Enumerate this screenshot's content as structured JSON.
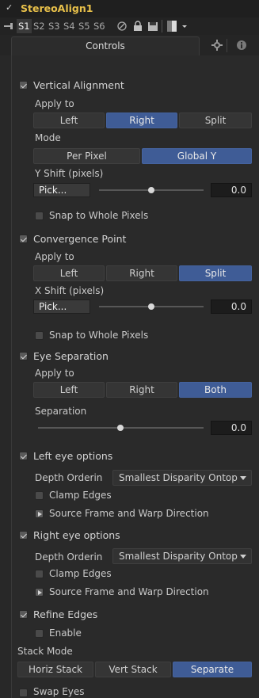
{
  "node": {
    "title": "StereoAlign1"
  },
  "slots": [
    "S1",
    "S2",
    "S3",
    "S4",
    "S5",
    "S6"
  ],
  "tabs": {
    "controls": "Controls"
  },
  "vertical": {
    "title": "Vertical Alignment",
    "apply_label": "Apply to",
    "apply_options": [
      "Left",
      "Right",
      "Split"
    ],
    "apply_selected": "Right",
    "mode_label": "Mode",
    "mode_options": [
      "Per Pixel",
      "Global Y"
    ],
    "mode_selected": "Global Y",
    "shift_label": "Y Shift (pixels)",
    "pick_label": "Pick...",
    "shift_value": "0.0",
    "shift_slider": 0.5,
    "snap_label": "Snap to Whole Pixels"
  },
  "convergence": {
    "title": "Convergence Point",
    "apply_label": "Apply to",
    "apply_options": [
      "Left",
      "Right",
      "Split"
    ],
    "apply_selected": "Split",
    "shift_label": "X Shift (pixels)",
    "pick_label": "Pick...",
    "shift_value": "0.0",
    "shift_slider": 0.5,
    "snap_label": "Snap to Whole Pixels"
  },
  "eye_sep": {
    "title": "Eye Separation",
    "apply_label": "Apply to",
    "apply_options": [
      "Left",
      "Right",
      "Both"
    ],
    "apply_selected": "Both",
    "sep_label": "Separation",
    "sep_value": "0.0",
    "sep_slider": 0.5
  },
  "left_eye": {
    "title": "Left eye options",
    "depth_label": "Depth Orderin",
    "depth_value": "Smallest Disparity Ontop",
    "clamp_label": "Clamp Edges",
    "source_label": "Source Frame and Warp Direction"
  },
  "right_eye": {
    "title": "Right eye options",
    "depth_label": "Depth Orderin",
    "depth_value": "Smallest Disparity Ontop",
    "clamp_label": "Clamp Edges",
    "source_label": "Source Frame and Warp Direction"
  },
  "refine": {
    "title": "Refine Edges",
    "enable_label": "Enable"
  },
  "stack": {
    "label": "Stack Mode",
    "options": [
      "Horiz Stack",
      "Vert Stack",
      "Separate"
    ],
    "selected": "Separate"
  },
  "swap": {
    "label": "Swap Eyes"
  }
}
